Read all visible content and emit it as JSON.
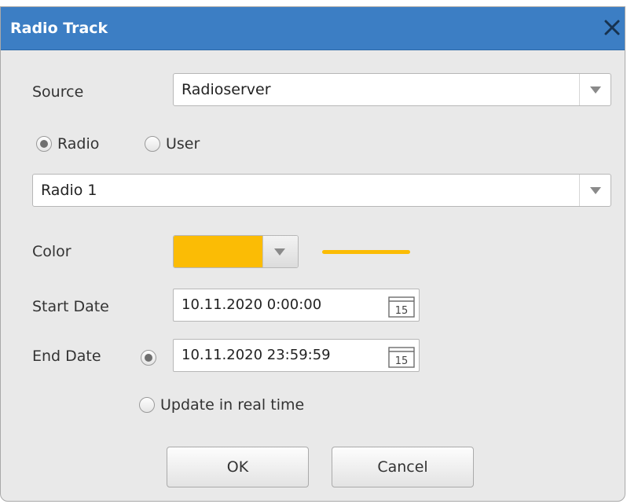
{
  "window": {
    "title": "Radio Track"
  },
  "source": {
    "label": "Source",
    "value": "Radioserver"
  },
  "target_type": {
    "options": [
      {
        "label": "Radio",
        "selected": true
      },
      {
        "label": "User",
        "selected": false
      }
    ]
  },
  "target": {
    "value": "Radio 1"
  },
  "color": {
    "label": "Color",
    "value": "#fbbc05"
  },
  "start_date": {
    "label": "Start Date",
    "value": "10.11.2020 0:00:00",
    "calendar_day": "15"
  },
  "end_date": {
    "label": "End Date",
    "value": "10.11.2020 23:59:59",
    "calendar_day": "15",
    "option_selected": true,
    "realtime_label": "Update in real time",
    "realtime_selected": false
  },
  "buttons": {
    "ok": "OK",
    "cancel": "Cancel"
  },
  "icons": {
    "close": "close-icon",
    "dropdown": "chevron-down-icon",
    "calendar": "calendar-icon"
  }
}
